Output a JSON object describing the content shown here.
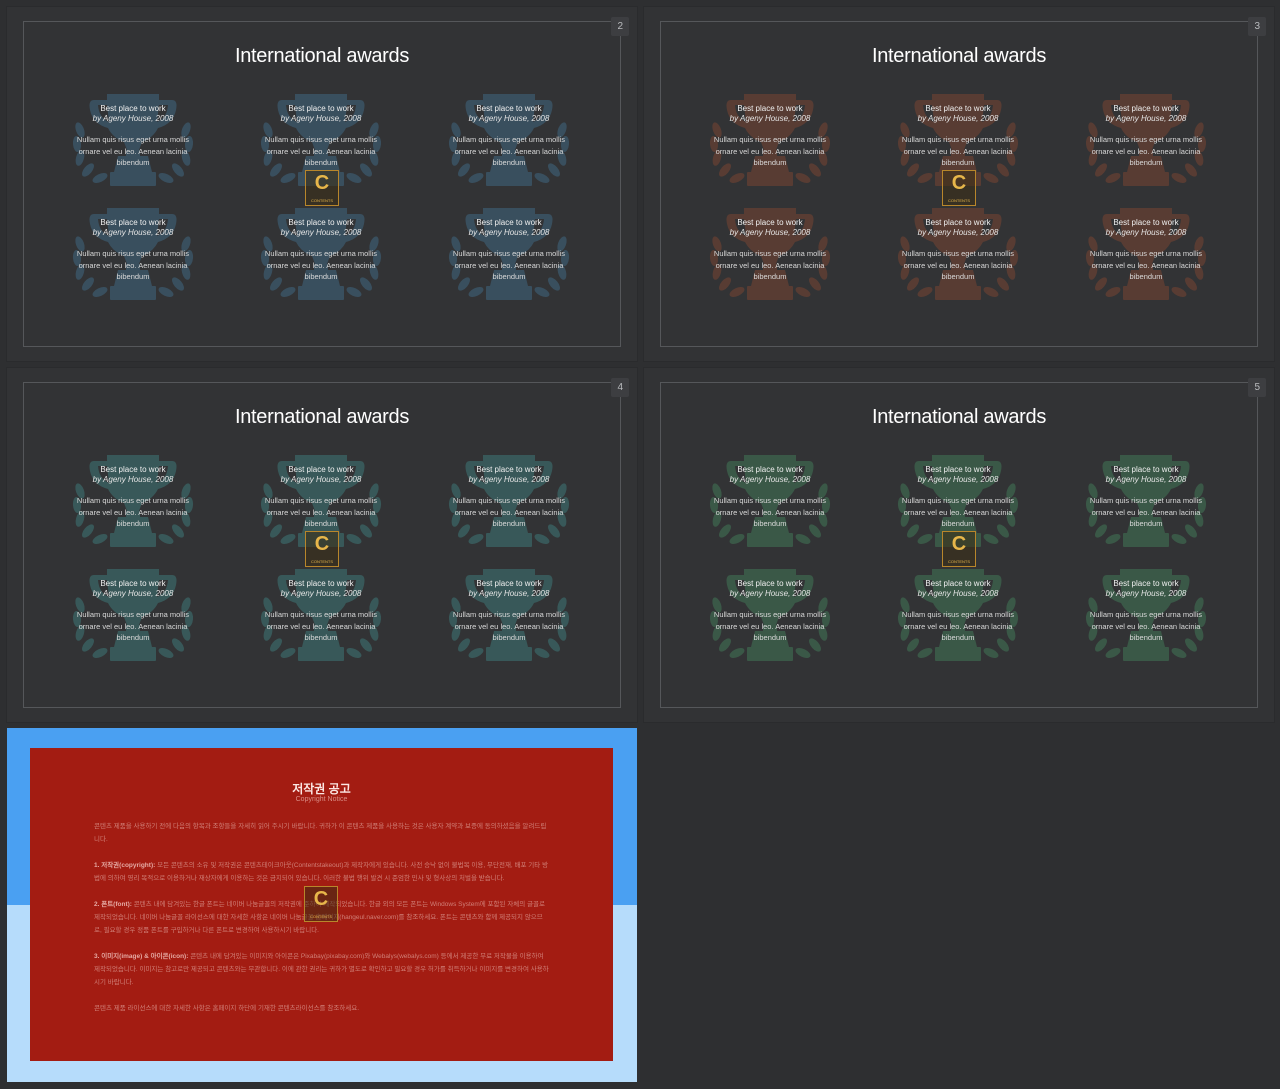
{
  "colors": {
    "trophy_blue": "#3a5161",
    "trophy_brown": "#5b3d33",
    "trophy_teal": "#395b51",
    "trophy_green": "#3b5a49",
    "copyright_panel": "#a31c12",
    "copyright_bg_top": "#4aa0f2",
    "copyright_bg_bottom": "#b6dcfb"
  },
  "watermark": {
    "letter": "C",
    "text": "CONTENTS"
  },
  "slides": [
    {
      "number": "2",
      "title": "International awards",
      "trophy_color": "#3a5161",
      "awards": [
        {
          "title": "Best place to work",
          "by": "by Ageny House, 2008",
          "desc": "Nullam quis risus eget urna mollis ornare vel eu leo. Aenean lacinia bibendum"
        },
        {
          "title": "Best place to work",
          "by": "by Ageny House, 2008",
          "desc": "Nullam quis risus eget urna mollis ornare vel eu leo. Aenean lacinia bibendum"
        },
        {
          "title": "Best place to work",
          "by": "by Ageny House, 2008",
          "desc": "Nullam quis risus eget urna mollis ornare vel eu leo. Aenean lacinia bibendum"
        },
        {
          "title": "Best place to work",
          "by": "by Ageny House, 2008",
          "desc": "Nullam quis risus eget urna mollis ornare vel eu leo. Aenean lacinia bibendum"
        },
        {
          "title": "Best place to work",
          "by": "by Ageny House, 2008",
          "desc": "Nullam quis risus eget urna mollis ornare vel eu leo. Aenean lacinia bibendum"
        },
        {
          "title": "Best place to work",
          "by": "by Ageny House, 2008",
          "desc": "Nullam quis risus eget urna mollis ornare vel eu leo. Aenean lacinia bibendum"
        }
      ]
    },
    {
      "number": "3",
      "title": "International awards",
      "trophy_color": "#5b3d33",
      "awards": [
        {
          "title": "Best place to work",
          "by": "by Ageny House, 2008",
          "desc": "Nullam quis risus eget urna mollis ornare vel eu leo. Aenean lacinia bibendum"
        },
        {
          "title": "Best place to work",
          "by": "by Ageny House, 2008",
          "desc": "Nullam quis risus eget urna mollis ornare vel eu leo. Aenean lacinia bibendum"
        },
        {
          "title": "Best place to work",
          "by": "by Ageny House, 2008",
          "desc": "Nullam quis risus eget urna mollis ornare vel eu leo. Aenean lacinia bibendum"
        },
        {
          "title": "Best place to work",
          "by": "by Ageny House, 2008",
          "desc": "Nullam quis risus eget urna mollis ornare vel eu leo. Aenean lacinia bibendum"
        },
        {
          "title": "Best place to work",
          "by": "by Ageny House, 2008",
          "desc": "Nullam quis risus eget urna mollis ornare vel eu leo. Aenean lacinia bibendum"
        },
        {
          "title": "Best place to work",
          "by": "by Ageny House, 2008",
          "desc": "Nullam quis risus eget urna mollis ornare vel eu leo. Aenean lacinia bibendum"
        }
      ]
    },
    {
      "number": "4",
      "title": "International awards",
      "trophy_color": "#395b5b",
      "awards": [
        {
          "title": "Best place to work",
          "by": "by Ageny House, 2008",
          "desc": "Nullam quis risus eget urna mollis ornare vel eu leo. Aenean lacinia bibendum"
        },
        {
          "title": "Best place to work",
          "by": "by Ageny House, 2008",
          "desc": "Nullam quis risus eget urna mollis ornare vel eu leo. Aenean lacinia bibendum"
        },
        {
          "title": "Best place to work",
          "by": "by Ageny House, 2008",
          "desc": "Nullam quis risus eget urna mollis ornare vel eu leo. Aenean lacinia bibendum"
        },
        {
          "title": "Best place to work",
          "by": "by Ageny House, 2008",
          "desc": "Nullam quis risus eget urna mollis ornare vel eu leo. Aenean lacinia bibendum"
        },
        {
          "title": "Best place to work",
          "by": "by Ageny House, 2008",
          "desc": "Nullam quis risus eget urna mollis ornare vel eu leo. Aenean lacinia bibendum"
        },
        {
          "title": "Best place to work",
          "by": "by Ageny House, 2008",
          "desc": "Nullam quis risus eget urna mollis ornare vel eu leo. Aenean lacinia bibendum"
        }
      ]
    },
    {
      "number": "5",
      "title": "International awards",
      "trophy_color": "#3b5a49",
      "awards": [
        {
          "title": "Best place to work",
          "by": "by Ageny House, 2008",
          "desc": "Nullam quis risus eget urna mollis ornare vel eu leo. Aenean lacinia bibendum"
        },
        {
          "title": "Best place to work",
          "by": "by Ageny House, 2008",
          "desc": "Nullam quis risus eget urna mollis ornare vel eu leo. Aenean lacinia bibendum"
        },
        {
          "title": "Best place to work",
          "by": "by Ageny House, 2008",
          "desc": "Nullam quis risus eget urna mollis ornare vel eu leo. Aenean lacinia bibendum"
        },
        {
          "title": "Best place to work",
          "by": "by Ageny House, 2008",
          "desc": "Nullam quis risus eget urna mollis ornare vel eu leo. Aenean lacinia bibendum"
        },
        {
          "title": "Best place to work",
          "by": "by Ageny House, 2008",
          "desc": "Nullam quis risus eget urna mollis ornare vel eu leo. Aenean lacinia bibendum"
        },
        {
          "title": "Best place to work",
          "by": "by Ageny House, 2008",
          "desc": "Nullam quis risus eget urna mollis ornare vel eu leo. Aenean lacinia bibendum"
        }
      ]
    }
  ],
  "copyright": {
    "title": "저작권 공고",
    "subtitle": "Copyright Notice",
    "intro": "콘텐츠 제품을 사용하기 전에 다음의 항목과 조항들을 자세히 읽어 주시기 바랍니다. 귀하가 이 콘텐츠 제품을 사용하는 것은 사용자 계약과 보증에 동의하셨음을 알려드립니다.",
    "s1_head": "1. 저작권(copyright):",
    "s1_body": " 모든 콘텐츠의 소유 및 저작권은 콘텐츠테이크아웃(Contentstakeout)과 제작자에게 있습니다. 사전 승낙 없이 불법복 이용, 무단전재, 배포 기타 방법에 의하여 영리 목적으로 이용하거나 재상자에게 이용하는 것은 금지되어 있습니다. 이러한 불법 행위 발견 시 준엄한 민사 및 형사상의 처벌을 받습니다.",
    "s2_head": "2. 폰트(font):",
    "s2_body": " 콘텐츠 내에 담겨있는 한글 폰트는 네이버 나눔글꼴의 저작권에 준하여 제작되었습니다. 한글 외의 모든 폰트는 Windows System에 포함된 자체의 글꼴로 제작되었습니다. 네이버 나눔글꼴 라이선스에 대한 자세한 사항은 네이버 나눔글꼴 홈페이지(hangeul.naver.com)를 참조하세요. 폰트는 콘텐츠와 함께 제공되지 않으므로, 필요할 경우 정품 폰트를 구입하거나 다른 폰트로 변경하여 사용하시기 바랍니다.",
    "s3_head": "3. 이미지(image) & 아이콘(icon):",
    "s3_body": " 콘텐츠 내에 담겨있는 이미지와 아이콘은 Pixabay(pixabay.com)와 Webalys(webalys.com) 등에서 제공한 무료 저작물을 이용하여 제작되었습니다. 이미지는 참고로만 제공되고 콘텐츠와는 무관합니다. 이에 관한 권리는 귀하가 별도로 확인하고 필요할 경우 허가를 취득하거나 이미지를 변경하여 사용하시기 바랍니다.",
    "footer": "콘텐츠 제품 라이선스에 대한 자세한 사항은 홈페이지 하단에 기재한 콘텐츠라이선스를 참조하세요."
  }
}
